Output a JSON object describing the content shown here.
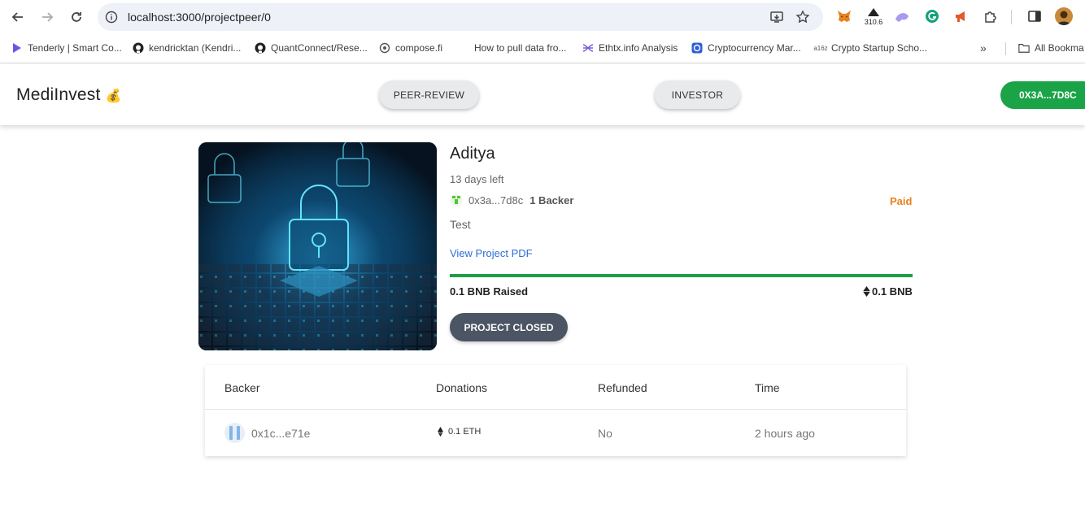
{
  "browser": {
    "url": "localhost:3000/projectpeer/0",
    "extension_badge": "310.6",
    "bookmarks": [
      {
        "label": "Tenderly | Smart Co...",
        "icon": "tenderly-icon"
      },
      {
        "label": "kendricktan (Kendri...",
        "icon": "github-icon"
      },
      {
        "label": "QuantConnect/Rese...",
        "icon": "github-icon"
      },
      {
        "label": "compose.fi",
        "icon": "compose-icon"
      },
      {
        "label": "How to pull data fro...",
        "icon": ""
      },
      {
        "label": "Ethtx.info Analysis",
        "icon": "ethtx-icon"
      },
      {
        "label": "Cryptocurrency Mar...",
        "icon": "coingecko-icon"
      },
      {
        "label": "Crypto Startup Scho...",
        "icon": "a16z-icon"
      }
    ],
    "all_bookmarks": "All Bookma"
  },
  "header": {
    "brand": "MediInvest",
    "brand_emoji": "💰",
    "nav": [
      "PEER-REVIEW",
      "INVESTOR"
    ],
    "wallet": "0X3A...7D8C"
  },
  "project": {
    "title": "Aditya",
    "days_left": "13 days left",
    "owner": "0x3a...7d8c",
    "backers": "1 Backer",
    "status": "Paid",
    "description": "Test",
    "pdf_link": "View Project PDF",
    "raised": "0.1 BNB Raised",
    "goal": "0.1 BNB",
    "progress": 1.0,
    "button": "PROJECT CLOSED"
  },
  "table": {
    "headers": [
      "Backer",
      "Donations",
      "Refunded",
      "Time"
    ],
    "rows": [
      {
        "backer": "0x1c...e71e",
        "donation": "0.1 ETH",
        "refunded": "No",
        "time": "2 hours ago"
      }
    ]
  },
  "colors": {
    "wallet": "#1aa347",
    "progress": "#1f9d47",
    "paid": "#e8821e",
    "link": "#2b6fd6",
    "closed_button": "#4b5563"
  }
}
